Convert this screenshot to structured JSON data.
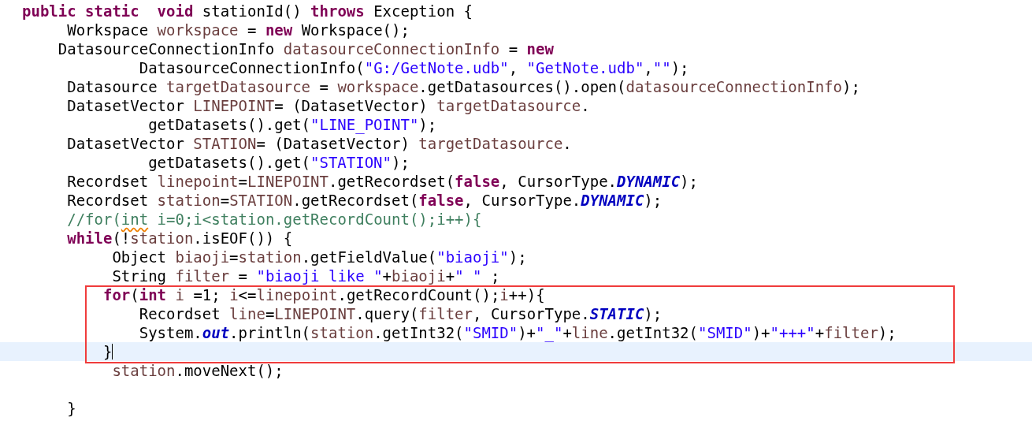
{
  "editor": {
    "lines": [
      {
        "kind": "code",
        "current": false,
        "boxed": false,
        "tokens": [
          {
            "kind": "keyword",
            "text": "public static  void"
          },
          {
            "kind": "plain",
            "text": " stationId() "
          },
          {
            "kind": "keyword",
            "text": "throws"
          },
          {
            "kind": "plain",
            "text": " Exception {"
          }
        ]
      },
      {
        "kind": "code",
        "current": false,
        "boxed": false,
        "tokens": [
          {
            "kind": "plain",
            "text": "     Workspace "
          },
          {
            "kind": "variable",
            "text": "workspace"
          },
          {
            "kind": "plain",
            "text": " = "
          },
          {
            "kind": "keyword",
            "text": "new"
          },
          {
            "kind": "plain",
            "text": " Workspace();"
          }
        ]
      },
      {
        "kind": "code",
        "current": false,
        "boxed": false,
        "tokens": [
          {
            "kind": "plain",
            "text": "    DatasourceConnectionInfo "
          },
          {
            "kind": "variable",
            "text": "datasourceConnectionInfo"
          },
          {
            "kind": "plain",
            "text": " = "
          },
          {
            "kind": "keyword",
            "text": "new"
          }
        ]
      },
      {
        "kind": "code",
        "current": false,
        "boxed": false,
        "tokens": [
          {
            "kind": "plain",
            "text": "             DatasourceConnectionInfo("
          },
          {
            "kind": "string",
            "text": "\"G:/GetNote.udb\""
          },
          {
            "kind": "plain",
            "text": ", "
          },
          {
            "kind": "string",
            "text": "\"GetNote.udb\""
          },
          {
            "kind": "plain",
            "text": ","
          },
          {
            "kind": "string",
            "text": "\"\""
          },
          {
            "kind": "plain",
            "text": ");"
          }
        ]
      },
      {
        "kind": "code",
        "current": false,
        "boxed": false,
        "tokens": [
          {
            "kind": "plain",
            "text": "     Datasource "
          },
          {
            "kind": "variable",
            "text": "targetDatasource"
          },
          {
            "kind": "plain",
            "text": " = "
          },
          {
            "kind": "variable",
            "text": "workspace"
          },
          {
            "kind": "plain",
            "text": ".getDatasources().open("
          },
          {
            "kind": "variable",
            "text": "datasourceConnectionInfo"
          },
          {
            "kind": "plain",
            "text": ");"
          }
        ]
      },
      {
        "kind": "code",
        "current": false,
        "boxed": false,
        "tokens": [
          {
            "kind": "plain",
            "text": "     DatasetVector "
          },
          {
            "kind": "variable",
            "text": "LINEPOINT"
          },
          {
            "kind": "plain",
            "text": "= (DatasetVector) "
          },
          {
            "kind": "variable",
            "text": "targetDatasource"
          },
          {
            "kind": "plain",
            "text": "."
          }
        ]
      },
      {
        "kind": "code",
        "current": false,
        "boxed": false,
        "tokens": [
          {
            "kind": "plain",
            "text": "              getDatasets().get("
          },
          {
            "kind": "string",
            "text": "\"LINE_POINT\""
          },
          {
            "kind": "plain",
            "text": ");"
          }
        ]
      },
      {
        "kind": "code",
        "current": false,
        "boxed": false,
        "tokens": [
          {
            "kind": "plain",
            "text": "     DatasetVector "
          },
          {
            "kind": "variable",
            "text": "STATION"
          },
          {
            "kind": "plain",
            "text": "= (DatasetVector) "
          },
          {
            "kind": "variable",
            "text": "targetDatasource"
          },
          {
            "kind": "plain",
            "text": "."
          }
        ]
      },
      {
        "kind": "code",
        "current": false,
        "boxed": false,
        "tokens": [
          {
            "kind": "plain",
            "text": "              getDatasets().get("
          },
          {
            "kind": "string",
            "text": "\"STATION\""
          },
          {
            "kind": "plain",
            "text": ");"
          }
        ]
      },
      {
        "kind": "code",
        "current": false,
        "boxed": false,
        "tokens": [
          {
            "kind": "plain",
            "text": "     Recordset "
          },
          {
            "kind": "variable",
            "text": "linepoint"
          },
          {
            "kind": "plain",
            "text": "="
          },
          {
            "kind": "variable",
            "text": "LINEPOINT"
          },
          {
            "kind": "plain",
            "text": ".getRecordset("
          },
          {
            "kind": "keyword",
            "text": "false"
          },
          {
            "kind": "plain",
            "text": ", CursorType."
          },
          {
            "kind": "static",
            "text": "DYNAMIC"
          },
          {
            "kind": "plain",
            "text": ");"
          }
        ]
      },
      {
        "kind": "code",
        "current": false,
        "boxed": false,
        "tokens": [
          {
            "kind": "plain",
            "text": "     Recordset "
          },
          {
            "kind": "variable",
            "text": "station"
          },
          {
            "kind": "plain",
            "text": "="
          },
          {
            "kind": "variable",
            "text": "STATION"
          },
          {
            "kind": "plain",
            "text": ".getRecordset("
          },
          {
            "kind": "keyword",
            "text": "false"
          },
          {
            "kind": "plain",
            "text": ", CursorType."
          },
          {
            "kind": "static",
            "text": "DYNAMIC"
          },
          {
            "kind": "plain",
            "text": ");"
          }
        ]
      },
      {
        "kind": "code",
        "current": false,
        "boxed": false,
        "tokens": [
          {
            "kind": "comment",
            "text": "     //for("
          },
          {
            "kind": "misspelled",
            "text": "int"
          },
          {
            "kind": "comment",
            "text": " i=0;i<station.getRecordCount();i++){"
          }
        ]
      },
      {
        "kind": "code",
        "current": false,
        "boxed": false,
        "tokens": [
          {
            "kind": "keyword",
            "text": "     while"
          },
          {
            "kind": "plain",
            "text": "(!"
          },
          {
            "kind": "variable",
            "text": "station"
          },
          {
            "kind": "plain",
            "text": ".isEOF()) {"
          }
        ]
      },
      {
        "kind": "code",
        "current": false,
        "boxed": false,
        "tokens": [
          {
            "kind": "plain",
            "text": "          Object "
          },
          {
            "kind": "variable",
            "text": "biaoji"
          },
          {
            "kind": "plain",
            "text": "="
          },
          {
            "kind": "variable",
            "text": "station"
          },
          {
            "kind": "plain",
            "text": ".getFieldValue("
          },
          {
            "kind": "string",
            "text": "\"biaoji\""
          },
          {
            "kind": "plain",
            "text": ");"
          }
        ]
      },
      {
        "kind": "code",
        "current": false,
        "boxed": false,
        "tokens": [
          {
            "kind": "plain",
            "text": "          String "
          },
          {
            "kind": "variable",
            "text": "filter"
          },
          {
            "kind": "plain",
            "text": " = "
          },
          {
            "kind": "string",
            "text": "\"biaoji like \""
          },
          {
            "kind": "plain",
            "text": "+"
          },
          {
            "kind": "variable",
            "text": "biaoji"
          },
          {
            "kind": "plain",
            "text": "+"
          },
          {
            "kind": "string",
            "text": "\" \""
          },
          {
            "kind": "plain",
            "text": " ;"
          }
        ]
      },
      {
        "kind": "code",
        "current": false,
        "boxed": true,
        "tokens": [
          {
            "kind": "keyword",
            "text": "         for"
          },
          {
            "kind": "plain",
            "text": "("
          },
          {
            "kind": "keyword",
            "text": "int"
          },
          {
            "kind": "variable",
            "text": " i"
          },
          {
            "kind": "plain",
            "text": " =1; "
          },
          {
            "kind": "variable",
            "text": "i"
          },
          {
            "kind": "plain",
            "text": "<="
          },
          {
            "kind": "variable",
            "text": "linepoint"
          },
          {
            "kind": "plain",
            "text": ".getRecordCount();"
          },
          {
            "kind": "variable",
            "text": "i"
          },
          {
            "kind": "plain",
            "text": "++){"
          }
        ]
      },
      {
        "kind": "code",
        "current": false,
        "boxed": true,
        "tokens": [
          {
            "kind": "plain",
            "text": "             Recordset "
          },
          {
            "kind": "variable",
            "text": "line"
          },
          {
            "kind": "plain",
            "text": "="
          },
          {
            "kind": "variable",
            "text": "LINEPOINT"
          },
          {
            "kind": "plain",
            "text": ".query("
          },
          {
            "kind": "variable",
            "text": "filter"
          },
          {
            "kind": "plain",
            "text": ", CursorType."
          },
          {
            "kind": "static",
            "text": "STATIC"
          },
          {
            "kind": "plain",
            "text": ");"
          }
        ]
      },
      {
        "kind": "code",
        "current": false,
        "boxed": true,
        "tokens": [
          {
            "kind": "plain",
            "text": "             System."
          },
          {
            "kind": "static",
            "text": "out"
          },
          {
            "kind": "plain",
            "text": ".println("
          },
          {
            "kind": "variable",
            "text": "station"
          },
          {
            "kind": "plain",
            "text": ".getInt32("
          },
          {
            "kind": "string",
            "text": "\"SMID\""
          },
          {
            "kind": "plain",
            "text": ")+"
          },
          {
            "kind": "string",
            "text": "\"_\""
          },
          {
            "kind": "plain",
            "text": "+"
          },
          {
            "kind": "variable",
            "text": "line"
          },
          {
            "kind": "plain",
            "text": ".getInt32("
          },
          {
            "kind": "string",
            "text": "\"SMID\""
          },
          {
            "kind": "plain",
            "text": ")+"
          },
          {
            "kind": "string",
            "text": "\"+++\""
          },
          {
            "kind": "plain",
            "text": "+"
          },
          {
            "kind": "variable",
            "text": "filter"
          },
          {
            "kind": "plain",
            "text": ");"
          }
        ]
      },
      {
        "kind": "code",
        "current": true,
        "boxed": true,
        "tokens": [
          {
            "kind": "plain",
            "text": "         }"
          }
        ]
      },
      {
        "kind": "code",
        "current": false,
        "boxed": false,
        "tokens": [
          {
            "kind": "variable",
            "text": "          station"
          },
          {
            "kind": "plain",
            "text": ".moveNext();"
          }
        ]
      },
      {
        "kind": "blank"
      },
      {
        "kind": "code",
        "current": false,
        "boxed": false,
        "tokens": [
          {
            "kind": "plain",
            "text": "     }"
          }
        ]
      }
    ]
  }
}
